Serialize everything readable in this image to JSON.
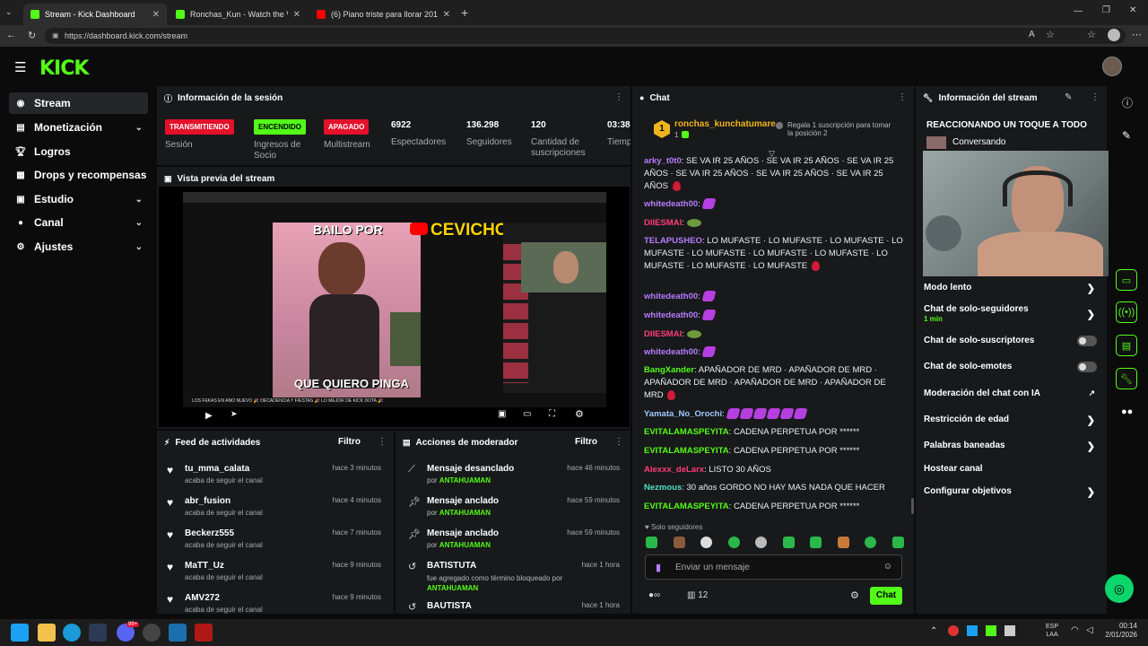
{
  "browser": {
    "tabs": [
      {
        "title": "Stream - Kick Dashboard",
        "favicon_color": "#53fc18"
      },
      {
        "title": "Ronchas_Kun - Watch the VOD on",
        "favicon_color": "#53fc18"
      },
      {
        "title": "(6) Piano triste para llorar 2018 - Y",
        "favicon_color": "#ff0000"
      }
    ],
    "url": "https://dashboard.kick.com/stream"
  },
  "brand": {
    "logo": "KICK",
    "accent": "#53fc18"
  },
  "sidebar": {
    "items": [
      {
        "label": "Stream",
        "icon": "broadcast-icon"
      },
      {
        "label": "Monetización",
        "icon": "money-icon"
      },
      {
        "label": "Logros",
        "icon": "trophy-icon"
      },
      {
        "label": "Drops y recompensas",
        "icon": "gift-icon"
      },
      {
        "label": "Estudio",
        "icon": "studio-icon"
      },
      {
        "label": "Canal",
        "icon": "user-icon"
      },
      {
        "label": "Ajustes",
        "icon": "gear-icon"
      }
    ]
  },
  "session": {
    "title": "Información de la sesión",
    "stats": [
      {
        "badge": "TRANSMITIENDO",
        "label": "Sesión"
      },
      {
        "badge": "ENCENDIDO",
        "label": "Ingresos de Socio"
      },
      {
        "badge": "APAGADO",
        "label": "Multistream"
      },
      {
        "value": "6922",
        "label": "Espectadores"
      },
      {
        "value": "136.298",
        "label": "Seguidores"
      },
      {
        "value": "120",
        "label": "Cantidad de suscripciones"
      },
      {
        "value": "03:38",
        "label": "Tiempo en vivo"
      }
    ]
  },
  "preview": {
    "title": "Vista previa del stream",
    "video_text_top": "BAILO POR",
    "video_brand": "CEVICHON",
    "video_text_bottom": "QUE QUIERO PINGA",
    "caption": "LOS FEKAS EN AÑO NUEVO 🎉 DECADENCIA Y FIESTAS 🎉 LO MEJOR DE KICK DOTA 🎉"
  },
  "feed": {
    "title": "Feed de actividades",
    "filter": "Filtro",
    "items": [
      {
        "user": "tu_mma_calata",
        "action": "acaba de seguir el canal",
        "time": "hace 3 minutos"
      },
      {
        "user": "abr_fusion",
        "action": "acaba de seguir el canal",
        "time": "hace 4 minutos"
      },
      {
        "user": "Beckerz555",
        "action": "acaba de seguir el canal",
        "time": "hace 7 minutos"
      },
      {
        "user": "MaTT_Uz",
        "action": "acaba de seguir el canal",
        "time": "hace 9 minutos"
      },
      {
        "user": "AMV272",
        "action": "acaba de seguir el canal",
        "time": "hace 9 minutos"
      }
    ]
  },
  "mod": {
    "title": "Acciones de moderador",
    "filter": "Filtro",
    "items": [
      {
        "action": "Mensaje desanclado",
        "detail": "por",
        "mod": "ANTAHUAMAN",
        "time": "hace 46 minutos"
      },
      {
        "action": "Mensaje anclado",
        "detail": "por",
        "mod": "ANTAHUAMAN",
        "time": "hace 59 minutos"
      },
      {
        "action": "Mensaje anclado",
        "detail": "por",
        "mod": "ANTAHUAMAN",
        "time": "hace 59 minutos"
      },
      {
        "action": "BATISTUTA",
        "detail": "fue agregado como término bloqueado por",
        "mod": "ANTAHUAMAN",
        "time": "hace 1 hora"
      },
      {
        "action": "BAUTISTA",
        "detail": "",
        "mod": "",
        "time": "hace 1 hora"
      }
    ]
  },
  "chat": {
    "title": "Chat",
    "top_user": "ronchas_kunchatumare",
    "top_rank": "1",
    "top_count": "1",
    "gift_text": "Regala 1 suscripción para tomar la posición 2",
    "messages": [
      {
        "user": "arky_t0t0",
        "color": "#b57cff",
        "text": "SE VA IR 25 AÑOS · SE VA IR 25 AÑOS · SE VA IR 25 AÑOS · SE VA IR 25 AÑOS · SE VA IR 25 AÑOS · SE VA IR 25 AÑOS"
      },
      {
        "user": "whitedeath00",
        "color": "#b57cff",
        "text": ""
      },
      {
        "user": "DIIESMAI",
        "color": "#ff3b7a",
        "text": ""
      },
      {
        "user": "TELAPUSHEO",
        "color": "#b57cff",
        "text": "LO MUFASTE · LO MUFASTE · LO MUFASTE · LO MUFASTE · LO MUFASTE · LO MUFASTE · LO MUFASTE · LO MUFASTE · LO MUFASTE · LO MUFASTE"
      },
      {
        "user": "whitedeath00",
        "color": "#b57cff",
        "text": ""
      },
      {
        "user": "whitedeath00",
        "color": "#b57cff",
        "text": ""
      },
      {
        "user": "DIIESMAI",
        "color": "#ff3b7a",
        "text": ""
      },
      {
        "user": "whitedeath00",
        "color": "#b57cff",
        "text": ""
      },
      {
        "user": "BangXander",
        "color": "#53fc18",
        "text": "APAÑADOR DE MRD · APAÑADOR DE MRD · APAÑADOR DE MRD · APAÑADOR DE MRD · APAÑADOR DE MRD"
      },
      {
        "user": "Yamata_No_Orochi",
        "color": "#9ecbff",
        "text": ""
      },
      {
        "user": "EVITALAMASPEYITA",
        "color": "#53fc18",
        "text": "CADENA PERPETUA POR ******"
      },
      {
        "user": "EVITALAMASPEYITA",
        "color": "#53fc18",
        "text": "CADENA PERPETUA POR ******"
      },
      {
        "user": "Alexxx_deLarx",
        "color": "#ff3b7a",
        "text": "LISTO 30 AÑOS"
      },
      {
        "user": "Nezmous",
        "color": "#4ee0c8",
        "text": "30 años GORDO NO HAY MAS NADA QUE HACER"
      },
      {
        "user": "EVITALAMASPEYITA",
        "color": "#53fc18",
        "text": "CADENA PERPETUA POR ******"
      }
    ],
    "followers_only": "Solo seguidores",
    "input_placeholder": "Enviar un mensaje",
    "viewer_count": "12",
    "send_label": "Chat"
  },
  "stream_info": {
    "title": "Información del stream",
    "stream_title": "REACCIONANDO UN TOQUE A TODO",
    "category": "Conversando",
    "settings": [
      {
        "label": "Modo lento",
        "sub": "",
        "control": "chevron"
      },
      {
        "label": "Chat de solo-seguidores",
        "sub": "1 min",
        "control": "chevron"
      },
      {
        "label": "Chat de solo-suscriptores",
        "sub": "",
        "control": "toggle"
      },
      {
        "label": "Chat de solo-emotes",
        "sub": "",
        "control": "toggle"
      },
      {
        "label": "Moderación del chat con IA",
        "sub": "",
        "control": "external"
      },
      {
        "label": "Restricción de edad",
        "sub": "",
        "control": "chevron"
      },
      {
        "label": "Palabras baneadas",
        "sub": "",
        "control": "chevron"
      },
      {
        "label": "Hostear canal",
        "sub": "",
        "control": "none"
      },
      {
        "label": "Configurar objetivos",
        "sub": "",
        "control": "chevron"
      }
    ]
  },
  "taskbar": {
    "lang": "ESP",
    "lang2": "LAA",
    "time": "00:14",
    "date": "2/01/2026",
    "badge": "99+"
  }
}
